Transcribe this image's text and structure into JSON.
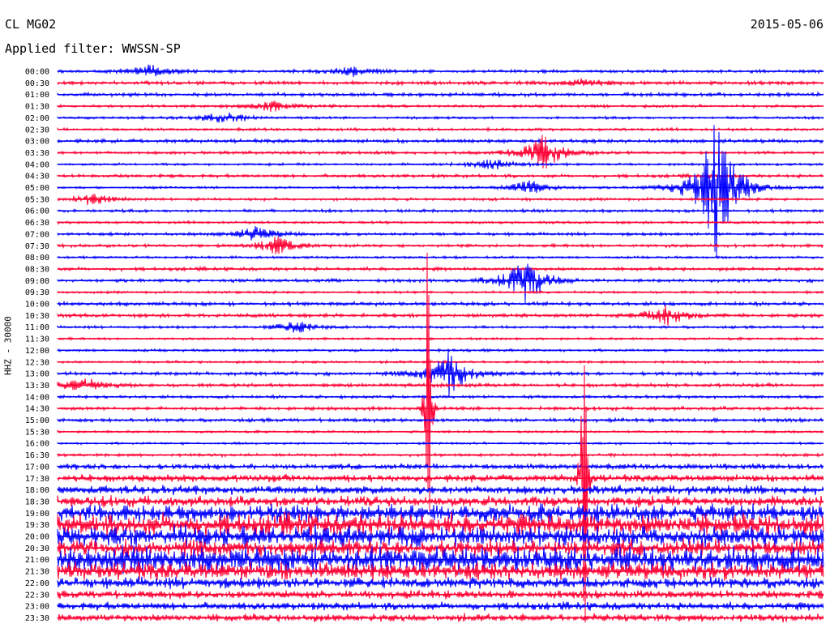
{
  "header": {
    "station": "CL MG02",
    "date": "2015-05-06",
    "filter": "Applied filter: WWSSN-SP"
  },
  "colors": {
    "blue": "#0000ff",
    "red": "#ff0033"
  },
  "chart_data": {
    "type": "line",
    "title": "CL MG02",
    "subtitle": "Applied filter: WWSSN-SP",
    "date": "2015-05-06",
    "ylabel": "HHZ - 30000",
    "x_range_minutes": [
      0,
      30
    ],
    "row_interval_minutes": 15,
    "grid": false,
    "tick_labels": [
      "00:00",
      "00:30",
      "01:00",
      "01:30",
      "02:00",
      "02:30",
      "03:00",
      "03:30",
      "04:00",
      "04:30",
      "05:00",
      "05:30",
      "06:00",
      "06:30",
      "07:00",
      "07:30",
      "08:00",
      "08:30",
      "09:00",
      "09:30",
      "10:00",
      "10:30",
      "11:00",
      "11:30",
      "12:00",
      "12:30",
      "13:00",
      "13:30",
      "14:00",
      "14:30",
      "15:00",
      "15:30",
      "16:00",
      "16:30",
      "17:00",
      "17:30",
      "18:00",
      "18:30",
      "19:00",
      "19:30",
      "20:00",
      "20:30",
      "21:00",
      "21:30",
      "22:00",
      "22:30",
      "23:00",
      "23:30"
    ],
    "series": [
      {
        "color": "blue",
        "rows": "even"
      },
      {
        "color": "red",
        "rows": "odd"
      }
    ],
    "events": [
      {
        "time": "00:00",
        "minute": 3.6,
        "amplitude": 8
      },
      {
        "time": "00:00",
        "minute": 11.5,
        "amplitude": 6
      },
      {
        "time": "00:30",
        "minute": 20.5,
        "amplitude": 4
      },
      {
        "time": "01:30",
        "minute": 8.4,
        "amplitude": 7
      },
      {
        "time": "02:00",
        "minute": 6.5,
        "amplitude": 8
      },
      {
        "time": "03:15",
        "minute": 19.0,
        "amplitude": 22
      },
      {
        "time": "04:00",
        "minute": 17.0,
        "amplitude": 8
      },
      {
        "time": "05:00",
        "minute": 18.5,
        "amplitude": 10
      },
      {
        "time": "05:30",
        "minute": 1.3,
        "amplitude": 8
      },
      {
        "time": "07:00",
        "minute": 7.8,
        "amplitude": 10
      },
      {
        "time": "07:30",
        "minute": 8.6,
        "amplitude": 12
      },
      {
        "time": "09:00",
        "minute": 18.3,
        "amplitude": 30
      },
      {
        "time": "10:15",
        "minute": 23.8,
        "amplitude": 14
      },
      {
        "time": "11:00",
        "minute": 9.3,
        "amplitude": 8
      },
      {
        "time": "13:00",
        "minute": 15.3,
        "amplitude": 28
      },
      {
        "time": "13:30",
        "minute": 1.0,
        "amplitude": 10
      },
      {
        "time": "14:15",
        "minute": 14.5,
        "amplitude": 260
      },
      {
        "time": "17:30",
        "minute": 20.6,
        "amplitude": 300
      },
      {
        "time": "05:00",
        "minute": 25.8,
        "amplitude": 90
      }
    ]
  }
}
